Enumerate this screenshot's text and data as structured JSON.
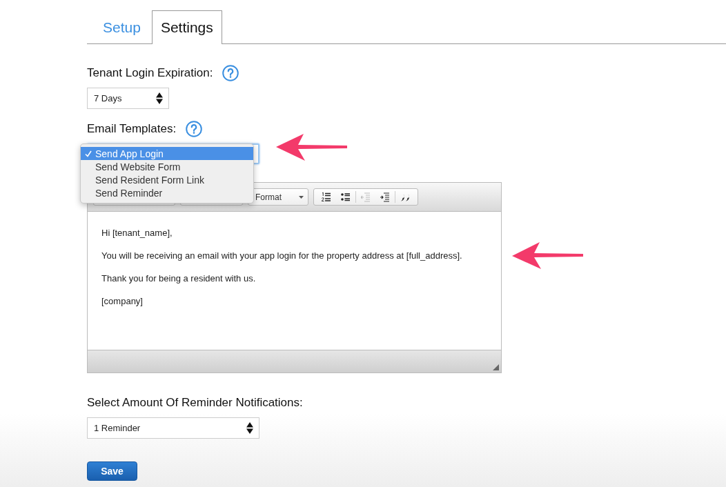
{
  "tabs": [
    {
      "label": "Setup",
      "selected": false
    },
    {
      "label": "Settings",
      "selected": true
    }
  ],
  "login_expiration": {
    "label": "Tenant Login Expiration:",
    "value": "7 Days"
  },
  "email_templates": {
    "label": "Email Templates:",
    "options": [
      {
        "label": "Send App Login",
        "selected": true
      },
      {
        "label": "Send Website Form",
        "selected": false
      },
      {
        "label": "Send Resident Form Link",
        "selected": false
      },
      {
        "label": "Send Reminder",
        "selected": false
      }
    ]
  },
  "editor": {
    "format_label": "Format",
    "toolbar": [
      {
        "kind": "ordered-list",
        "disabled": false
      },
      {
        "kind": "bullet-list",
        "disabled": false
      },
      {
        "kind": "outdent",
        "disabled": true
      },
      {
        "kind": "indent",
        "disabled": false
      },
      {
        "kind": "blockquote",
        "disabled": false
      }
    ],
    "paragraphs": [
      "Hi [tenant_name],",
      "You will be receiving an email with your app login for the property address at [full_address].",
      "Thank you for being a resident with us.",
      "[company]"
    ]
  },
  "reminders": {
    "label": "Select Amount Of Reminder Notifications:",
    "value": "1 Reminder"
  },
  "save_button": "Save"
}
